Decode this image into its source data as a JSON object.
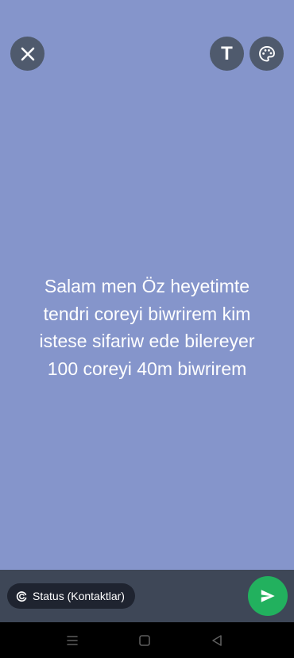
{
  "colors": {
    "background": "#8595cb",
    "top_button": "#4f5a6d",
    "bottom_bar": "#3e4757",
    "chip": "#1f2430",
    "send_button": "#22b15e",
    "nav_bar": "#000000",
    "nav_icon": "#5d5d5d",
    "text": "#ffffff"
  },
  "toolbar": {
    "close_icon": "close-icon",
    "text_tool_label": "T",
    "palette_icon": "palette-icon"
  },
  "status": {
    "text": "Salam men  Öz heyetimte\ntendri  coreyi biwrirem kim\nistese sifariw ede bilereyer\n100 coreyi 40m  biwrirem"
  },
  "bottom_bar": {
    "audience_label": "Status (Kontaktlar)",
    "audience_icon": "status-ring-icon",
    "send_icon": "send-icon"
  },
  "nav": {
    "menu_icon": "recent-apps-icon",
    "home_icon": "home-icon",
    "back_icon": "back-icon"
  }
}
